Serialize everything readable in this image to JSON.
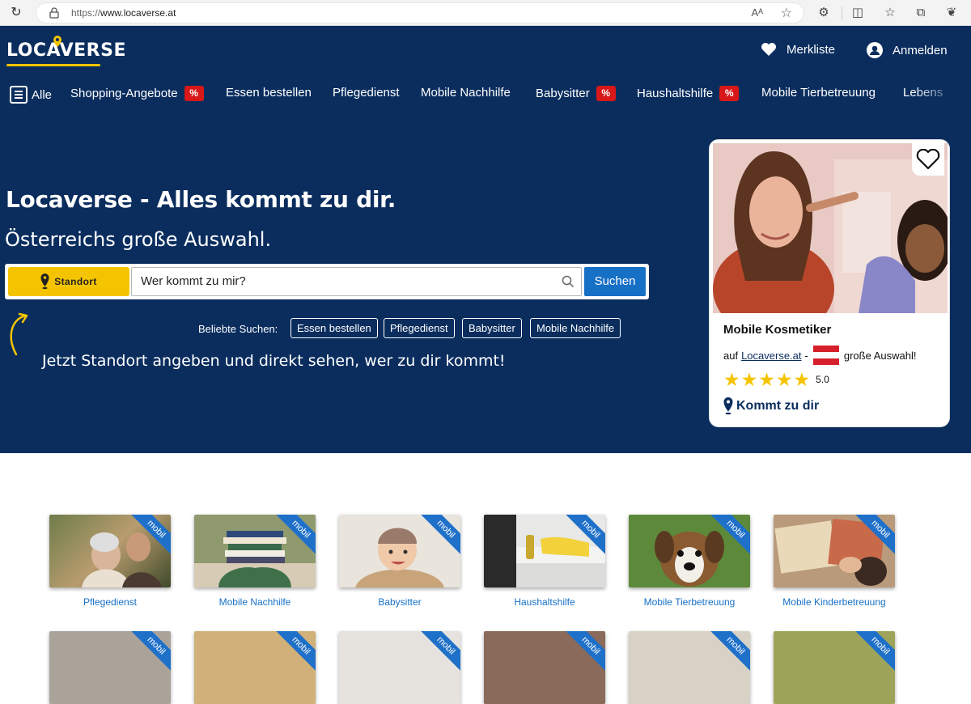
{
  "browser": {
    "url_protocol": "https://",
    "url_host": "www.locaverse.at",
    "reader_label": "Aᴬ"
  },
  "header": {
    "logo": "LOCAVERSE",
    "wishlist": "Merkliste",
    "login": "Anmelden"
  },
  "nav": {
    "items": [
      {
        "label": "Alle"
      },
      {
        "label": "Shopping-Angebote",
        "badge": "%"
      },
      {
        "label": "Essen bestellen"
      },
      {
        "label": "Pflegedienst"
      },
      {
        "label": "Mobile Nachhilfe"
      },
      {
        "label": "Babysitter",
        "badge": "%"
      },
      {
        "label": "Haushaltshilfe",
        "badge": "%"
      },
      {
        "label": "Mobile Tierbetreuung"
      },
      {
        "label": "Lebens"
      }
    ]
  },
  "hero": {
    "title": "Locaverse - Alles kommt zu dir.",
    "subtitle": "Österreichs große Auswahl.",
    "standort_label": "Standort",
    "search_placeholder": "Wer kommt zu mir?",
    "search_button": "Suchen",
    "popular_label": "Beliebte Suchen:",
    "popular": [
      "Essen bestellen",
      "Pflegedienst",
      "Babysitter",
      "Mobile Nachhilfe"
    ],
    "locate_text": "Jetzt Standort angeben und direkt sehen, wer zu dir kommt!"
  },
  "card": {
    "title": "Mobile Kosmetiker",
    "prefix": "auf",
    "link": "Locaverse.at",
    "dash": "-",
    "suffix": "große Auswahl!",
    "rating": "5.0",
    "stars": 5,
    "cta": "Kommt zu dir"
  },
  "categories": {
    "ribbon": "mobil",
    "items": [
      {
        "label": "Pflegedienst"
      },
      {
        "label": "Mobile Nachhilfe"
      },
      {
        "label": "Babysitter"
      },
      {
        "label": "Haushaltshilfe"
      },
      {
        "label": "Mobile Tierbetreuung"
      },
      {
        "label": "Mobile Kinderbetreuung"
      }
    ]
  },
  "colors": {
    "brand_navy": "#0a2d5e",
    "accent_yellow": "#f5c400",
    "button_blue": "#1670c6",
    "badge_red": "#d81818"
  }
}
